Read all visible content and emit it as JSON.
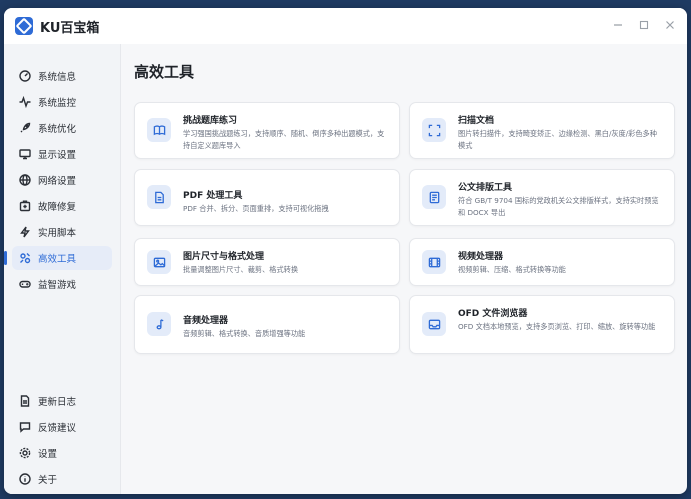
{
  "app": {
    "title": "KU百宝箱"
  },
  "sidebar": {
    "items": [
      {
        "label": "系统信息",
        "icon": "gauge-icon"
      },
      {
        "label": "系统监控",
        "icon": "pulse-icon"
      },
      {
        "label": "系统优化",
        "icon": "rocket-icon"
      },
      {
        "label": "显示设置",
        "icon": "monitor-icon"
      },
      {
        "label": "网络设置",
        "icon": "globe-icon"
      },
      {
        "label": "故障修复",
        "icon": "first-aid-icon"
      },
      {
        "label": "实用脚本",
        "icon": "lightning-icon"
      },
      {
        "label": "高效工具",
        "icon": "tools-icon",
        "active": true
      },
      {
        "label": "益智游戏",
        "icon": "gamepad-icon"
      }
    ],
    "bottom_items": [
      {
        "label": "更新日志",
        "icon": "document-icon"
      },
      {
        "label": "反馈建议",
        "icon": "chat-icon"
      },
      {
        "label": "设置",
        "icon": "settings-icon"
      },
      {
        "label": "关于",
        "icon": "info-icon"
      }
    ]
  },
  "main": {
    "title": "高效工具",
    "cards": [
      {
        "title": "挑战题库练习",
        "desc": "学习强国挑战题练习，支持顺序、随机、倒序多种出题模式，支持自定义题库导入",
        "icon": "book-icon"
      },
      {
        "title": "扫描文档",
        "desc": "图片转扫描件，支持畸变矫正、边缘检测、黑白/灰度/彩色多种模式",
        "icon": "scan-icon"
      },
      {
        "title": "PDF 处理工具",
        "desc": "PDF 合并、拆分、页面重排，支持可视化拖拽",
        "icon": "pdf-file-icon"
      },
      {
        "title": "公文排版工具",
        "desc": "符合 GB/T 9704 国标的党政机关公文排版样式，支持实时预览和 DOCX 导出",
        "icon": "document-layout-icon"
      },
      {
        "title": "图片尺寸与格式处理",
        "desc": "批量调整图片尺寸、裁剪、格式转换",
        "icon": "image-icon"
      },
      {
        "title": "视频处理器",
        "desc": "视频剪辑、压缩、格式转换等功能",
        "icon": "film-icon"
      },
      {
        "title": "音频处理器",
        "desc": "音频剪辑、格式转换、音质增强等功能",
        "icon": "music-note-icon"
      },
      {
        "title": "OFD 文件浏览器",
        "desc": "OFD 文档本地预览，支持多页浏览、打印、缩放、旋转等功能",
        "icon": "inbox-icon"
      }
    ]
  }
}
